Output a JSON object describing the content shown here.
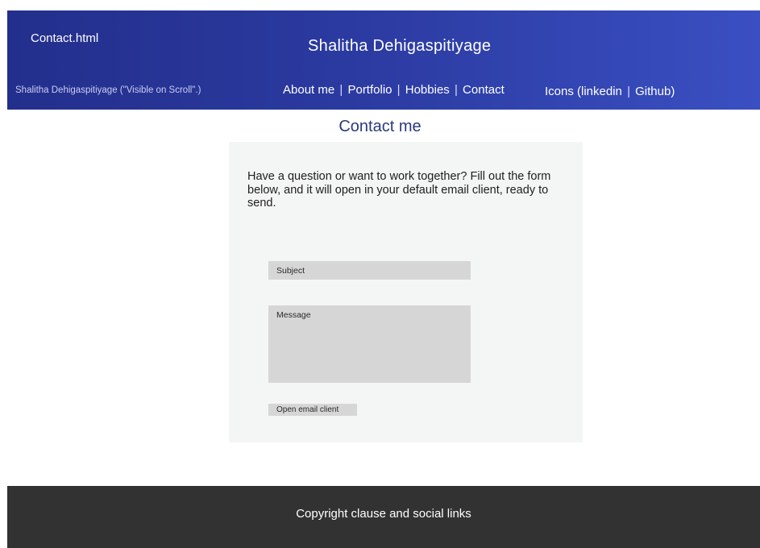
{
  "header": {
    "file_label": "Contact.html",
    "site_title": "Shalitha Dehigaspitiyage",
    "scroll_name": "Shalitha Dehigaspitiyage (\"Visible on Scroll\".)",
    "nav": {
      "about": "About me",
      "portfolio": "Portfolio",
      "hobbies": "Hobbies",
      "contact": "Contact",
      "separator": "|"
    },
    "icons": {
      "prefix": "Icons (",
      "linkedin": "linkedin",
      "github": "Github",
      "suffix": ")"
    },
    "gradient": [
      "#232f8c",
      "#3a4fc2"
    ]
  },
  "main": {
    "heading": "Contact me",
    "intro": "Have a question or want to work together? Fill out the form below, and it will open in your default email client, ready to send.",
    "form": {
      "subject_placeholder": "Subject",
      "message_placeholder": "Message",
      "submit_label": "Open email client"
    }
  },
  "footer": {
    "text": "Copyright clause and social links",
    "color": "#323232"
  }
}
